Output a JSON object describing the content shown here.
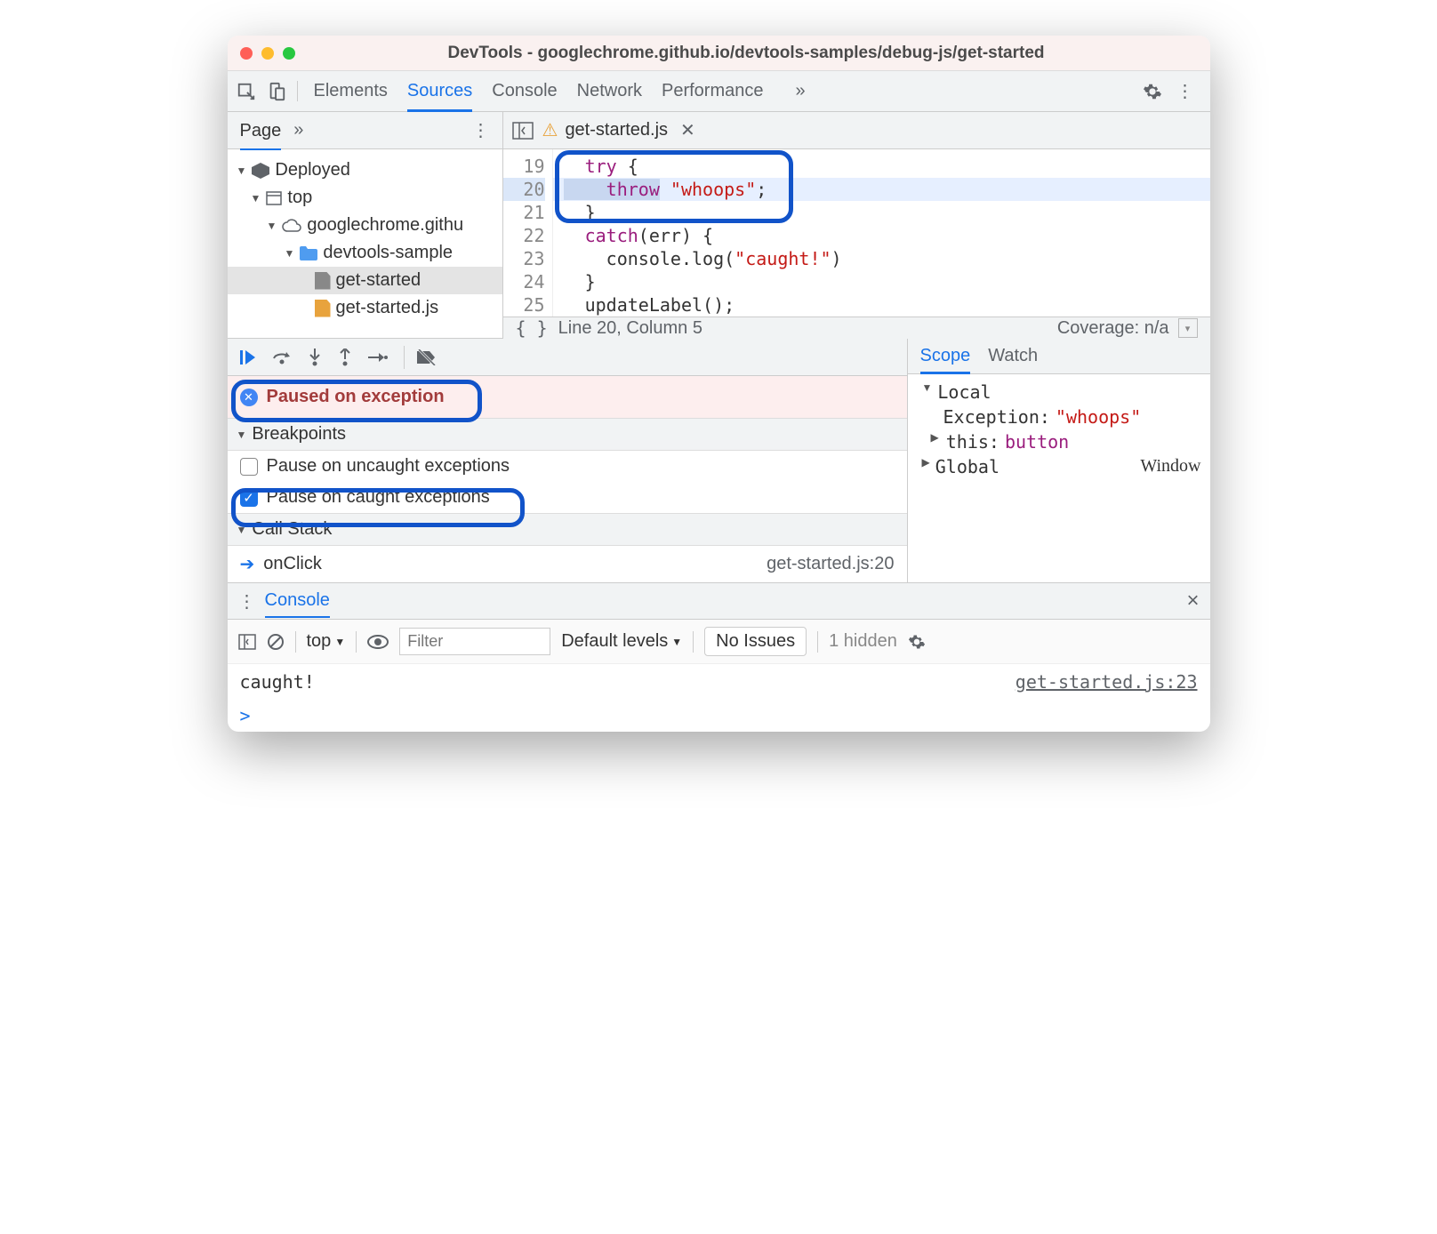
{
  "title": "DevTools - googlechrome.github.io/devtools-samples/debug-js/get-started",
  "toolbar": {
    "tabs": [
      "Elements",
      "Sources",
      "Console",
      "Network",
      "Performance"
    ],
    "more": "»"
  },
  "subbar": {
    "page": "Page",
    "more": "»",
    "file": "get-started.js"
  },
  "tree": {
    "deployed": "Deployed",
    "top": "top",
    "domain": "googlechrome.githu",
    "folder": "devtools-sample",
    "file1": "get-started",
    "file2": "get-started.js"
  },
  "code": {
    "lines": [
      "19",
      "20",
      "21",
      "22",
      "23",
      "24",
      "25"
    ],
    "l19a": "  try",
    "l19b": " {",
    "l20a": "    throw",
    "l20b": " \"whoops\"",
    "l20c": ";",
    "l21": "  }",
    "l22a": "  catch",
    "l22b": "(err) {",
    "l23a": "    console.log(",
    "l23b": "\"caught!\"",
    "l23c": ")",
    "l24": "  }",
    "l25": "  updateLabel();"
  },
  "status": {
    "braces": "{ }",
    "pos": "Line 20, Column 5",
    "cov": "Coverage: n/a"
  },
  "paused": "Paused on exception",
  "breakpoints": {
    "hdr": "Breakpoints",
    "uncaught": "Pause on uncaught exceptions",
    "caught": "Pause on caught exceptions"
  },
  "callstack": {
    "hdr": "Call Stack",
    "fn": "onClick",
    "loc": "get-started.js:20"
  },
  "scope": {
    "tab1": "Scope",
    "tab2": "Watch",
    "local": "Local",
    "exc_k": "Exception: ",
    "exc_v": "\"whoops\"",
    "this_k": "this: ",
    "this_v": "button",
    "global": "Global",
    "global_v": "Window"
  },
  "console": {
    "tab": "Console",
    "top": "top",
    "filter_ph": "Filter",
    "levels": "Default levels",
    "noissues": "No Issues",
    "hidden": "1 hidden",
    "log": "caught!",
    "src": "get-started.js:23",
    "prompt": ">"
  }
}
